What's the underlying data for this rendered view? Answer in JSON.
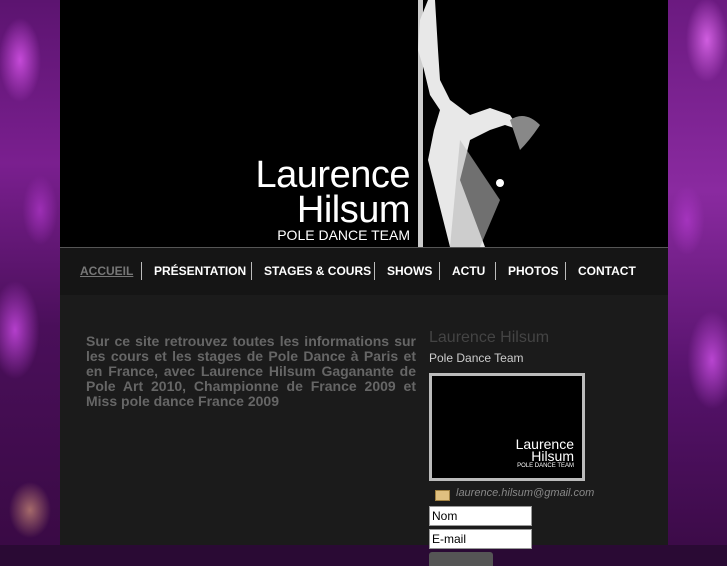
{
  "header": {
    "logo_line1": "Laurence",
    "logo_line2": "Hilsum",
    "logo_line3": "POLE DANCE TEAM"
  },
  "nav": {
    "items": [
      {
        "label": "ACCUEIL",
        "active": true
      },
      {
        "label": "PRÉSENTATION"
      },
      {
        "label": "STAGES & COURS"
      },
      {
        "label": "SHOWS"
      },
      {
        "label": "ACTU"
      },
      {
        "label": "PHOTOS"
      },
      {
        "label": "CONTACT"
      }
    ]
  },
  "main": {
    "intro": "Sur ce site retrouvez toutes les informations sur les cours et les stages de Pole Dance à Paris et en France, avec Laurence Hilsum Gaganante de Pole Art 2010, Championne de France 2009 et Miss pole dance France 2009"
  },
  "sidebar": {
    "title": "Laurence Hilsum",
    "subtitle": "Pole Dance Team",
    "image_logo_line1": "Laurence",
    "image_logo_line2": "Hilsum",
    "image_logo_line3": "POLE DANCE TEAM",
    "email": "laurence.hilsum@gmail.com",
    "form": {
      "name_value": "Nom",
      "email_value": "E-mail"
    }
  },
  "colors": {
    "nav_active": "#777777",
    "accent_purple": "#7a1f8f"
  }
}
